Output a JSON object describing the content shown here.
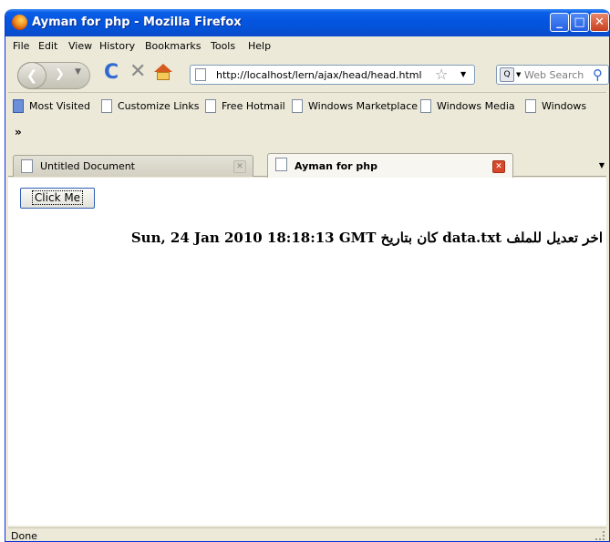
{
  "window": {
    "title": "Ayman for php - Mozilla Firefox"
  },
  "menu": [
    "File",
    "Edit",
    "View",
    "History",
    "Bookmarks",
    "Tools",
    "Help"
  ],
  "address": {
    "url": "http://localhost/lern/ajax/head/head.html"
  },
  "search": {
    "placeholder": "Web Search"
  },
  "bookmarks": [
    "Most Visited",
    "Customize Links",
    "Free Hotmail",
    "Windows Marketplace",
    "Windows Media",
    "Windows"
  ],
  "tabs": [
    {
      "label": "Untitled Document"
    },
    {
      "label": "Ayman for php"
    }
  ],
  "page": {
    "button_label": "Click Me",
    "result_text": "اخر تعديل للملف data.txt كان بتاريخ Sun, 24 Jan 2010 18:18:13 GMT"
  },
  "status": {
    "text": "Done"
  }
}
